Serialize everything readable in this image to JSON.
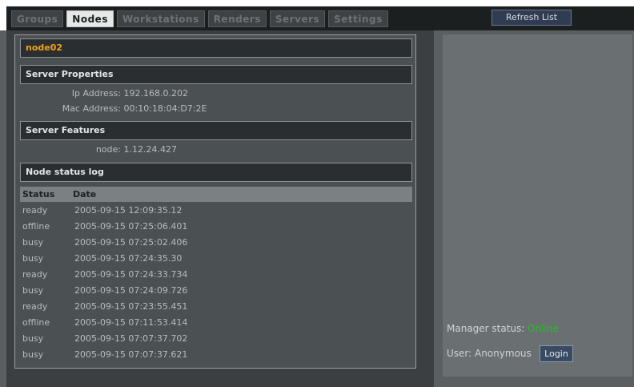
{
  "tabs": [
    {
      "label": "Groups",
      "active": false
    },
    {
      "label": "Nodes",
      "active": true
    },
    {
      "label": "Workstations",
      "active": false
    },
    {
      "label": "Renders",
      "active": false
    },
    {
      "label": "Servers",
      "active": false
    },
    {
      "label": "Settings",
      "active": false
    }
  ],
  "toolbar": {
    "refresh_label": "Refresh List"
  },
  "node": {
    "name": "node02"
  },
  "server_properties": {
    "header": "Server Properties",
    "ip_label": "Ip Address:",
    "ip_value": "192.168.0.202",
    "mac_label": "Mac Address:",
    "mac_value": "00:10:18:04:D7:2E"
  },
  "server_features": {
    "header": "Server Features",
    "node_label": "node:",
    "node_value": "1.12.24.427"
  },
  "status_log": {
    "header": "Node status log",
    "columns": [
      "Status",
      "Date"
    ],
    "rows": [
      {
        "status": "ready",
        "date": "2005-09-15 12:09:35.12"
      },
      {
        "status": "offline",
        "date": "2005-09-15 07:25:06.401"
      },
      {
        "status": "busy",
        "date": "2005-09-15 07:25:02.406"
      },
      {
        "status": "busy",
        "date": "2005-09-15 07:24:35.30"
      },
      {
        "status": "ready",
        "date": "2005-09-15 07:24:33.734"
      },
      {
        "status": "busy",
        "date": "2005-09-15 07:24:09.726"
      },
      {
        "status": "ready",
        "date": "2005-09-15 07:23:55.451"
      },
      {
        "status": "offline",
        "date": "2005-09-15 07:11:53.414"
      },
      {
        "status": "busy",
        "date": "2005-09-15 07:07:37.702"
      },
      {
        "status": "busy",
        "date": "2005-09-15 07:07:37.621"
      }
    ]
  },
  "manager": {
    "status_label": "Manager status:",
    "status_value": "Online",
    "status_color": "#22c022",
    "user_label": "User:",
    "user_value": "Anonymous",
    "login_label": "Login"
  }
}
